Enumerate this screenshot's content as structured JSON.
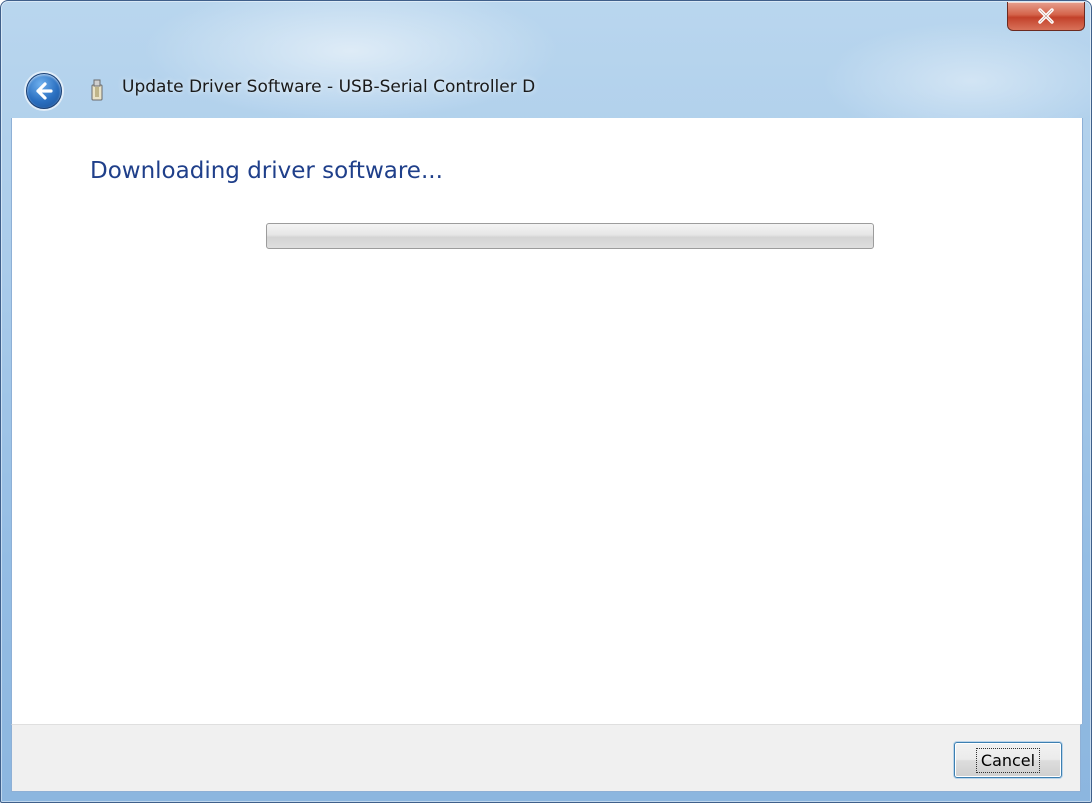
{
  "window": {
    "title": "Update Driver Software - USB-Serial Controller D"
  },
  "heading": "Downloading driver software...",
  "progress": {
    "value": 0
  },
  "footer": {
    "cancel_label": "Cancel"
  },
  "icons": {
    "close": "close-icon",
    "back": "back-arrow-icon",
    "device": "usb-device-icon"
  },
  "colors": {
    "heading": "#1f3f8a",
    "close_button": "#c2412a",
    "back_button": "#2a6fc0",
    "focus_border": "#3c7fb1"
  }
}
